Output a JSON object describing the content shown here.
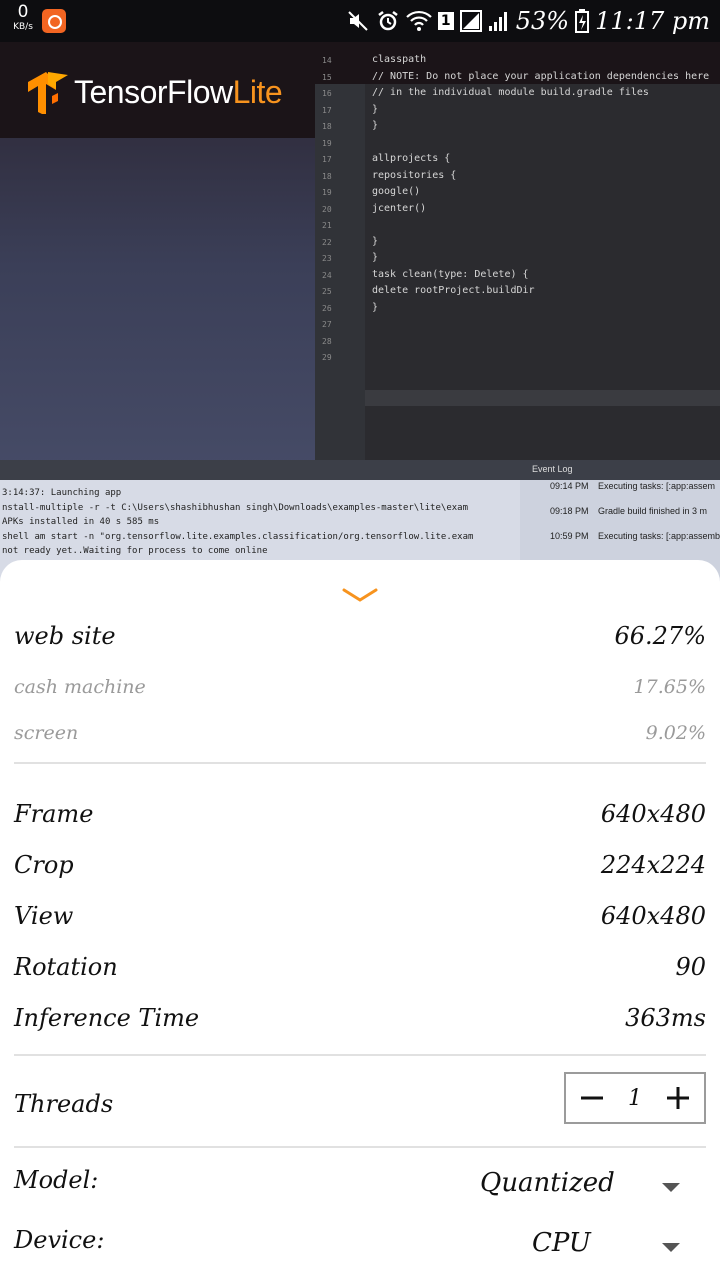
{
  "status_bar": {
    "speed_value": "0",
    "speed_unit": "KB/s",
    "sim_slot": "1",
    "battery": "53%",
    "time": "11:17 pm"
  },
  "preview": {
    "logo_text": "TensorFlow",
    "logo_suffix": "Lite",
    "code_lines": [
      {
        "n": "14",
        "t": "    classpath"
      },
      {
        "n": "15",
        "t": "    // NOTE: Do not place your application dependencies here"
      },
      {
        "n": "16",
        "t": "    // in the individual module build.gradle files"
      },
      {
        "n": "17",
        "t": "  }"
      },
      {
        "n": "18",
        "t": "}"
      },
      {
        "n": "19",
        "t": ""
      },
      {
        "n": "17",
        "t": "allprojects {"
      },
      {
        "n": "18",
        "t": "    repositories {"
      },
      {
        "n": "19",
        "t": "        google()"
      },
      {
        "n": "20",
        "t": "        jcenter()"
      },
      {
        "n": "21",
        "t": ""
      },
      {
        "n": "22",
        "t": "    }"
      },
      {
        "n": "23",
        "t": "}"
      },
      {
        "n": "24",
        "t": "task clean(type: Delete) {"
      },
      {
        "n": "25",
        "t": "    delete rootProject.buildDir"
      },
      {
        "n": "26",
        "t": "}"
      },
      {
        "n": "27",
        "t": ""
      },
      {
        "n": "28",
        "t": ""
      },
      {
        "n": "29",
        "t": ""
      }
    ],
    "console_lines": [
      "3:14:37: Launching app",
      "nstall-multiple -r -t C:\\Users\\shashibhushan singh\\Downloads\\examples-master\\lite\\exam",
      "APKs installed in 40 s 585 ms",
      "shell am start -n \"org.tensorflow.lite.examples.classification/org.tensorflow.lite.exam",
      " not ready yet..Waiting for process to come online"
    ],
    "event_log": {
      "title": "Event Log",
      "entries": [
        {
          "time": "09:14 PM",
          "text": "Executing tasks: [:app:assem"
        },
        {
          "time": "09:18 PM",
          "text": "Gradle build finished in 3 m"
        },
        {
          "time": "10:59 PM",
          "text": "Executing tasks: [:app:assemb"
        }
      ]
    }
  },
  "results": [
    {
      "label": "web site",
      "value": "66.27%"
    },
    {
      "label": "cash machine",
      "value": "17.65%"
    },
    {
      "label": "screen",
      "value": "9.02%"
    }
  ],
  "info": [
    {
      "label": "Frame",
      "value": "640x480"
    },
    {
      "label": "Crop",
      "value": "224x224"
    },
    {
      "label": "View",
      "value": "640x480"
    },
    {
      "label": "Rotation",
      "value": "90"
    },
    {
      "label": "Inference Time",
      "value": "363ms"
    }
  ],
  "threads": {
    "label": "Threads",
    "value": "1"
  },
  "model": {
    "label": "Model:",
    "selected": "Quantized"
  },
  "device": {
    "label": "Device:",
    "selected": "CPU"
  },
  "colors": {
    "accent": "#f7931e",
    "text": "#111111",
    "muted": "#9a9a9a"
  }
}
